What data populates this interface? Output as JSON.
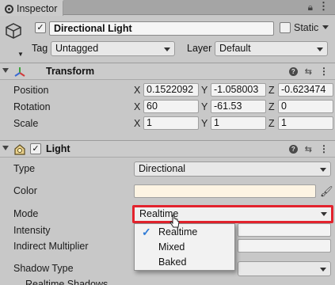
{
  "window": {
    "tab_title": "Inspector",
    "lock_icon": "lock-icon",
    "menu_icon": "kebab-menu-icon"
  },
  "gameobject": {
    "name": "Directional Light",
    "enabled_checkmark": "✓",
    "static_label": "Static",
    "tag_label": "Tag",
    "tag_value": "Untagged",
    "layer_label": "Layer",
    "layer_value": "Default"
  },
  "transform": {
    "title": "Transform",
    "rows": [
      {
        "label": "Position",
        "x": "0.1522092",
        "y": "-1.058003",
        "z": "-0.623474"
      },
      {
        "label": "Rotation",
        "x": "60",
        "y": "-61.53",
        "z": "0"
      },
      {
        "label": "Scale",
        "x": "1",
        "y": "1",
        "z": "1"
      }
    ],
    "axis": {
      "x": "X",
      "y": "Y",
      "z": "Z"
    }
  },
  "light": {
    "title": "Light",
    "enabled_checkmark": "✓",
    "type_label": "Type",
    "type_value": "Directional",
    "color_label": "Color",
    "color_value": "#fdf4e3",
    "mode_label": "Mode",
    "mode_value": "Realtime",
    "intensity_label": "Intensity",
    "indirect_label": "Indirect Multiplier",
    "shadow_type_label": "Shadow Type",
    "realtime_shadows_label": "Realtime Shadows"
  },
  "mode_menu": {
    "options": [
      "Realtime",
      "Mixed",
      "Baked"
    ],
    "checkmark": "✓"
  },
  "colors": {
    "highlight_border": "#e3232d",
    "check_blue": "#2f7bd6"
  }
}
